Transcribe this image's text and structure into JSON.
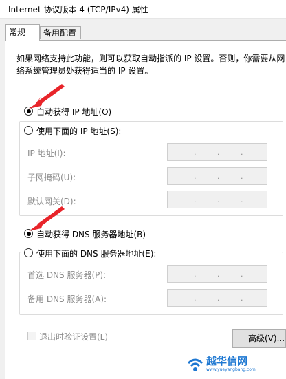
{
  "window": {
    "title": "Internet 协议版本 4 (TCP/IPv4) 属性"
  },
  "tabs": [
    {
      "label": "常规",
      "active": true
    },
    {
      "label": "备用配置",
      "active": false
    }
  ],
  "description": {
    "line1": "如果网络支持此功能，则可以获取自动指派的 IP 设置。否则，你需要从网",
    "line2": "络系统管理员处获得适当的 IP 设置。"
  },
  "ip_section": {
    "auto_option": {
      "label": "自动获得 IP 地址(O)",
      "selected": true
    },
    "manual_option": {
      "label": "使用下面的 IP 地址(S):",
      "selected": false
    },
    "fields": [
      {
        "label": "IP 地址(I):",
        "value": ". . ."
      },
      {
        "label": "子网掩码(U):",
        "value": ". . ."
      },
      {
        "label": "默认网关(D):",
        "value": ". . ."
      }
    ]
  },
  "dns_section": {
    "auto_option": {
      "label": "自动获得 DNS 服务器地址(B)",
      "selected": true
    },
    "manual_option": {
      "label": "使用下面的 DNS 服务器地址(E):",
      "selected": false
    },
    "fields": [
      {
        "label": "首选 DNS 服务器(P):",
        "value": ". . ."
      },
      {
        "label": "备用 DNS 服务器(A):",
        "value": ". . ."
      }
    ]
  },
  "validate_on_exit": {
    "label": "退出时验证设置(L)",
    "checked": false
  },
  "advanced_button": {
    "label": "高级(V)..."
  },
  "watermark": {
    "text": "越华信网",
    "url": "www.yueyangbang.com"
  },
  "colors": {
    "annotation_arrow": "#e8242a",
    "watermark": "#1e78d2"
  },
  "icons": [
    "red-annotation-arrow",
    "wifi-logo-icon"
  ]
}
